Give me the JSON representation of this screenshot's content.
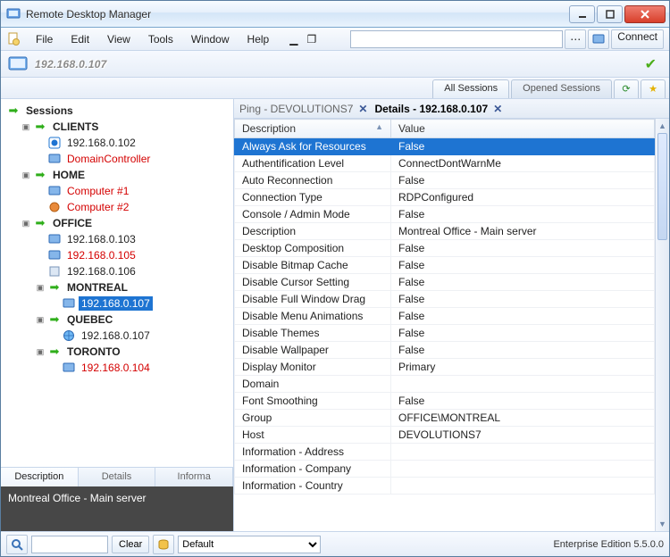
{
  "window": {
    "title": "Remote Desktop Manager"
  },
  "menu": {
    "file": "File",
    "edit": "Edit",
    "view": "View",
    "tools": "Tools",
    "window": "Window",
    "help": "Help",
    "connect": "Connect"
  },
  "address": {
    "ip": "192.168.0.107"
  },
  "sessionTabs": {
    "all": "All Sessions",
    "opened": "Opened Sessions"
  },
  "tree": {
    "root": "Sessions",
    "clients": {
      "label": "CLIENTS",
      "n0": "192.168.0.102",
      "n1": "DomainController"
    },
    "home": {
      "label": "HOME",
      "n0": "Computer #1",
      "n1": "Computer #2"
    },
    "office": {
      "label": "OFFICE",
      "n0": "192.168.0.103",
      "n1": "192.168.0.105",
      "n2": "192.168.0.106",
      "montreal": {
        "label": "MONTREAL",
        "n0": "192.168.0.107"
      },
      "quebec": {
        "label": "QUEBEC",
        "n0": "192.168.0.107"
      },
      "toronto": {
        "label": "TORONTO",
        "n0": "192.168.0.104"
      }
    }
  },
  "leftTabs": {
    "description": "Description",
    "details": "Details",
    "information": "Informa"
  },
  "leftDesc": "Montreal Office - Main server",
  "docTabs": {
    "ping": "Ping - DEVOLUTIONS7",
    "details": "Details - 192.168.0.107"
  },
  "grid": {
    "colDesc": "Description",
    "colVal": "Value",
    "rows": [
      {
        "d": "Always Ask for Resources",
        "v": "False",
        "sel": true
      },
      {
        "d": "Authentification Level",
        "v": "ConnectDontWarnMe"
      },
      {
        "d": "Auto Reconnection",
        "v": "False"
      },
      {
        "d": "Connection Type",
        "v": "RDPConfigured"
      },
      {
        "d": "Console / Admin Mode",
        "v": "False"
      },
      {
        "d": "Description",
        "v": "Montreal Office - Main server"
      },
      {
        "d": "Desktop Composition",
        "v": "False"
      },
      {
        "d": "Disable Bitmap Cache",
        "v": "False"
      },
      {
        "d": "Disable Cursor Setting",
        "v": "False"
      },
      {
        "d": "Disable Full Window Drag",
        "v": "False"
      },
      {
        "d": "Disable Menu Animations",
        "v": "False"
      },
      {
        "d": "Disable Themes",
        "v": "False"
      },
      {
        "d": "Disable Wallpaper",
        "v": "False"
      },
      {
        "d": "Display Monitor",
        "v": "Primary"
      },
      {
        "d": "Domain",
        "v": ""
      },
      {
        "d": "Font Smoothing",
        "v": "False"
      },
      {
        "d": "Group",
        "v": "OFFICE\\MONTREAL"
      },
      {
        "d": "Host",
        "v": "DEVOLUTIONS7"
      },
      {
        "d": "Information - Address",
        "v": ""
      },
      {
        "d": "Information - Company",
        "v": ""
      },
      {
        "d": "Information - Country",
        "v": ""
      }
    ]
  },
  "footer": {
    "clear": "Clear",
    "default": "Default",
    "edition": "Enterprise Edition 5.5.0.0"
  }
}
